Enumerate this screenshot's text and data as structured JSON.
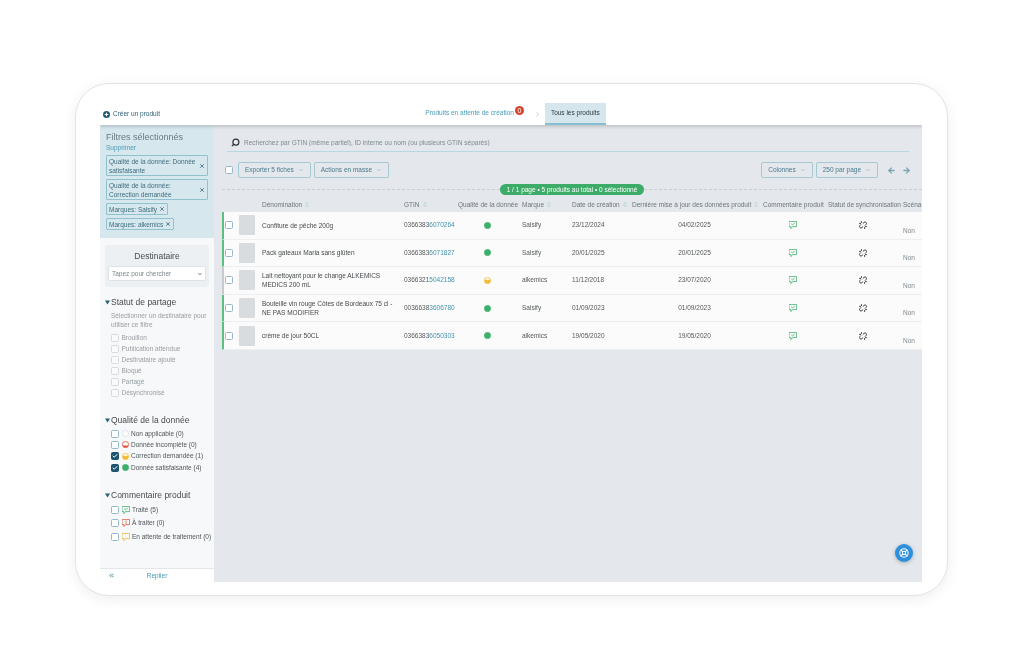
{
  "top_bar": {
    "create_button": "Créer un produit",
    "tabs": [
      {
        "label": "Produits en attente de création",
        "badge": "0",
        "selected": false
      },
      {
        "label": "Tous les produits",
        "selected": true
      }
    ]
  },
  "selected_filters": {
    "title": "Filtres sélectionnés",
    "clear_link": "Supprimer",
    "chips": [
      {
        "label": "Qualité de la donnée: Donnée satisfaisante"
      },
      {
        "label": "Qualité de la donnée: Correction demandée"
      },
      {
        "label": "Marques: Salsify"
      },
      {
        "label": "Marques: alkemics"
      }
    ]
  },
  "recipient": {
    "title": "Destinataire",
    "placeholder": "Tapez pour chercher"
  },
  "filter_sections": [
    {
      "kind": "status",
      "title": "Statut de partage",
      "expanded": true,
      "disabled": true,
      "note": "Sélectionner un destinataire pour utiliser ce filtre",
      "options": [
        {
          "label": "Brouillon",
          "checked": false
        },
        {
          "label": "Publication attendue",
          "checked": false
        },
        {
          "label": "Destinataire ajouté",
          "checked": false
        },
        {
          "label": "Bloqué",
          "checked": false
        },
        {
          "label": "Partagé",
          "checked": false
        },
        {
          "label": "Désynchronisé",
          "checked": false
        }
      ]
    },
    {
      "kind": "quality",
      "title": "Qualité de la donnée",
      "expanded": true,
      "disabled": false,
      "options": [
        {
          "label": "Non applicable (0)",
          "checked": false,
          "kind": "inapplicable"
        },
        {
          "label": "Donnée incomplète (0)",
          "checked": false,
          "kind": "incomplete"
        },
        {
          "label": "Correction demandée (1)",
          "checked": true,
          "kind": "correction"
        },
        {
          "label": "Donnée satisfaisante (4)",
          "checked": true,
          "kind": "satisfied"
        }
      ]
    },
    {
      "kind": "comment",
      "title": "Commentaire produit",
      "expanded": true,
      "disabled": false,
      "options": [
        {
          "label": "Traité (5)",
          "checked": false,
          "kind": "treated"
        },
        {
          "label": "À traiter (0)",
          "checked": false,
          "kind": "todo"
        },
        {
          "label": "En attente de traitement (0)",
          "checked": false,
          "kind": "pending"
        }
      ]
    }
  ],
  "sidebar_footer": {
    "collapse_button": "Replier"
  },
  "search": {
    "placeholder": "Recherchez par GTIN (même partiel), ID interne ou nom (ou plusieurs GTIN séparés)"
  },
  "toolbar": {
    "select_all_checked": false,
    "actions": [
      "Exporter 5 fiches",
      "Actions en masse"
    ],
    "view_options": [
      "Colonnes",
      "250 par page"
    ]
  },
  "summary": "1 / 1 page • 5 produits au total • 0 sélectionné",
  "table": {
    "columns": [
      {
        "label": "Dénomination",
        "sortable": true
      },
      {
        "label": "GTIN",
        "sortable": true
      },
      {
        "label": "Qualité de la donnée",
        "sortable": false
      },
      {
        "label": "Marque",
        "sortable": true
      },
      {
        "label": "Date de création",
        "sortable": true
      },
      {
        "label": "Dernière mise à jour des données produit",
        "sortable": true
      },
      {
        "label": "Commentaire produit",
        "sortable": false
      },
      {
        "label": "Statut de synchronisation",
        "sortable": false
      },
      {
        "label": "Scéna",
        "sortable": false
      }
    ],
    "rows": [
      {
        "selected": false,
        "name": "Confiture de pêche 200g",
        "gtin": {
          "prefix": "0366383",
          "link": "6070264"
        },
        "quality": {
          "kind": "satisfied"
        },
        "brand": "Salsify",
        "created": "23/12/2024",
        "updated": "04/02/2025",
        "comment": {
          "kind": "treated"
        },
        "sync": {
          "kind": "unlinked"
        },
        "column_9": "Non"
      },
      {
        "selected": false,
        "name": "Pack gateaux Maria sans glûten",
        "gtin": {
          "prefix": "0366383",
          "link": "6071827"
        },
        "quality": {
          "kind": "satisfied"
        },
        "brand": "Salsify",
        "created": "20/01/2025",
        "updated": "20/01/2025",
        "comment": {
          "kind": "treated"
        },
        "sync": {
          "kind": "unlinked"
        },
        "column_9": "Non"
      },
      {
        "selected": false,
        "name": "Lait nettoyant pour le change ALKEMICS MEDICS 200 mL",
        "gtin": {
          "prefix": "0366321",
          "link": "5042158"
        },
        "quality": {
          "kind": "correction"
        },
        "brand": "alkemics",
        "created": "11/12/2018",
        "updated": "23/07/2020",
        "comment": {
          "kind": "treated"
        },
        "sync": {
          "kind": "unlinked"
        },
        "column_9": "Non"
      },
      {
        "selected": false,
        "name": "Bouteille vin rouge Côtes de Bordeaux 75 cl - NE PAS MODIFIER",
        "gtin": {
          "prefix": "0036638",
          "link": "3606780"
        },
        "quality": {
          "kind": "satisfied"
        },
        "brand": "Salsify",
        "created": "01/09/2023",
        "updated": "01/09/2023",
        "comment": {
          "kind": "treated"
        },
        "sync": {
          "kind": "unlinked"
        },
        "column_9": "Non"
      },
      {
        "selected": false,
        "name": "crème de jour 50CL",
        "gtin": {
          "prefix": "0366383",
          "link": "6050303"
        },
        "quality": {
          "kind": "satisfied"
        },
        "brand": "alkemics",
        "created": "19/05/2020",
        "updated": "19/05/2020",
        "comment": {
          "kind": "treated"
        },
        "sync": {
          "kind": "unlinked"
        },
        "column_9": "Non"
      }
    ]
  }
}
